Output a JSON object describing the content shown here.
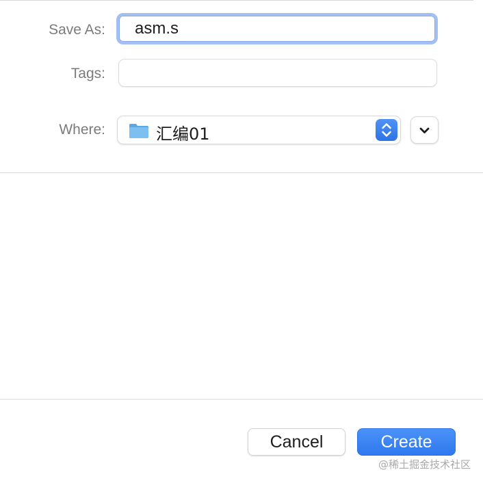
{
  "form": {
    "save_as_label": "Save As:",
    "file_name": "asm.s",
    "tags_label": "Tags:",
    "tags_value": "",
    "where_label": "Where:",
    "where_value": "汇编01"
  },
  "icons": {
    "folder": "folder-icon",
    "stepper": "up-down-chevron-icon",
    "expand": "chevron-down-icon"
  },
  "buttons": {
    "cancel_label": "Cancel",
    "create_label": "Create"
  },
  "watermark": "@稀土掘金技术社区",
  "colors": {
    "accent": "#3b82f0",
    "focus_ring": "#a4c0f2",
    "folder": "#6eb4ea",
    "label_text": "#7b7b7b"
  }
}
